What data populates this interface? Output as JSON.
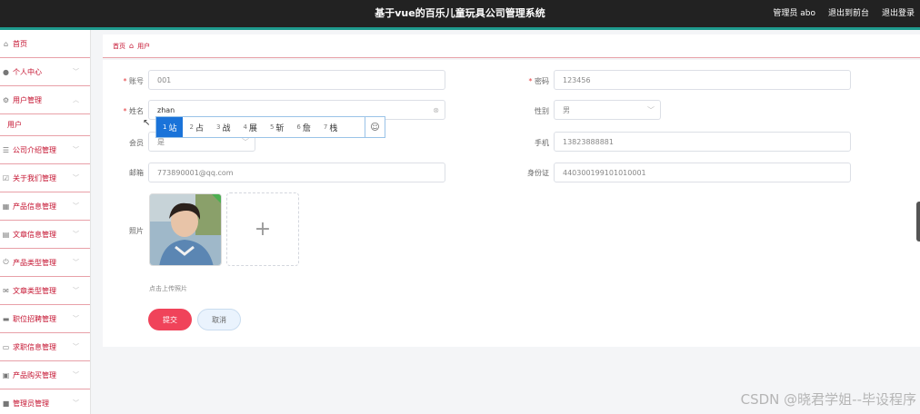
{
  "header": {
    "title": "基于vue的百乐儿童玩具公司管理系统",
    "user": "管理员 abo",
    "back_to_front": "退出到前台",
    "logout": "退出登录"
  },
  "sidebar": {
    "items": [
      {
        "label": "首页",
        "icon": "home-icon"
      },
      {
        "label": "个人中心",
        "icon": "user-icon"
      },
      {
        "label": "用户管理",
        "icon": "gear-icon"
      },
      {
        "label": "公司介绍管理",
        "icon": "list-icon"
      },
      {
        "label": "关于我们管理",
        "icon": "check-icon"
      },
      {
        "label": "产品信息管理",
        "icon": "grid-icon"
      },
      {
        "label": "文章信息管理",
        "icon": "doc-icon"
      },
      {
        "label": "产品类型管理",
        "icon": "power-icon"
      },
      {
        "label": "文章类型管理",
        "icon": "mail-icon"
      },
      {
        "label": "职位招聘管理",
        "icon": "card-icon"
      },
      {
        "label": "求职信息管理",
        "icon": "monitor-icon"
      },
      {
        "label": "产品购买管理",
        "icon": "cart-icon"
      },
      {
        "label": "管理员管理",
        "icon": "admin-icon"
      }
    ],
    "sub_item": "用户"
  },
  "breadcrumb": {
    "home": "首页",
    "current": "用户"
  },
  "form": {
    "account_label": "账号",
    "account_value": "001",
    "password_label": "密码",
    "password_value": "123456",
    "name_label": "姓名",
    "name_value": "zhan",
    "gender_label": "性别",
    "gender_value": "男",
    "member_label": "会员",
    "member_value": "是",
    "phone_label": "手机",
    "phone_value": "13823888881",
    "email_label": "邮箱",
    "email_value": "773890001@qq.com",
    "idcard_label": "身份证",
    "idcard_value": "440300199101010001",
    "photo_label": "照片",
    "upload_hint": "点击上传照片",
    "submit": "提交",
    "cancel": "取消"
  },
  "ime": {
    "candidates": [
      {
        "n": "1",
        "c": "站"
      },
      {
        "n": "2",
        "c": "占"
      },
      {
        "n": "3",
        "c": "战"
      },
      {
        "n": "4",
        "c": "展"
      },
      {
        "n": "5",
        "c": "斩"
      },
      {
        "n": "6",
        "c": "詹"
      },
      {
        "n": "7",
        "c": "栈"
      }
    ],
    "emoji": "☺"
  },
  "watermark": "CSDN @晓君学姐--毕设程序"
}
